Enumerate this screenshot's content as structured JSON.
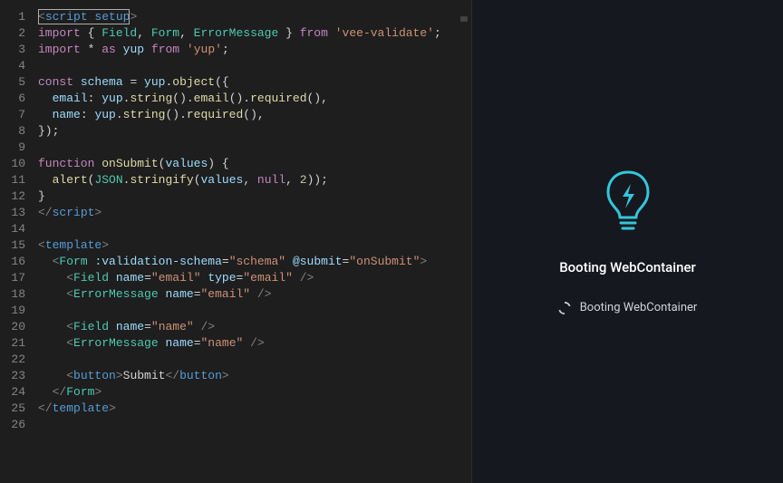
{
  "editor": {
    "lines": [
      {
        "n": 1,
        "tokens": [
          [
            "<",
            "punc"
          ],
          [
            "script setup",
            "tag"
          ],
          [
            ">",
            "punc"
          ]
        ],
        "cursor_start": true,
        "cursor_end_ch": 14
      },
      {
        "n": 2,
        "tokens": [
          [
            "import",
            "key"
          ],
          [
            " { ",
            "plain"
          ],
          [
            "Field",
            "type"
          ],
          [
            ", ",
            "plain"
          ],
          [
            "Form",
            "type"
          ],
          [
            ", ",
            "plain"
          ],
          [
            "ErrorMessage",
            "type"
          ],
          [
            " } ",
            "plain"
          ],
          [
            "from",
            "key"
          ],
          [
            " ",
            "plain"
          ],
          [
            "'vee-validate'",
            "str"
          ],
          [
            ";",
            "plain"
          ]
        ]
      },
      {
        "n": 3,
        "tokens": [
          [
            "import",
            "key"
          ],
          [
            " ",
            "plain"
          ],
          [
            "*",
            "op"
          ],
          [
            " ",
            "plain"
          ],
          [
            "as",
            "key"
          ],
          [
            " ",
            "plain"
          ],
          [
            "yup",
            "ident"
          ],
          [
            " ",
            "plain"
          ],
          [
            "from",
            "key"
          ],
          [
            " ",
            "plain"
          ],
          [
            "'yup'",
            "str"
          ],
          [
            ";",
            "plain"
          ]
        ]
      },
      {
        "n": 4,
        "tokens": []
      },
      {
        "n": 5,
        "tokens": [
          [
            "const",
            "key"
          ],
          [
            " ",
            "plain"
          ],
          [
            "schema",
            "ident"
          ],
          [
            " = ",
            "plain"
          ],
          [
            "yup",
            "ident"
          ],
          [
            ".",
            "plain"
          ],
          [
            "object",
            "fn"
          ],
          [
            "({",
            "plain"
          ]
        ]
      },
      {
        "n": 6,
        "tokens": [
          [
            "  ",
            "plain"
          ],
          [
            "email",
            "ident"
          ],
          [
            ": ",
            "plain"
          ],
          [
            "yup",
            "ident"
          ],
          [
            ".",
            "plain"
          ],
          [
            "string",
            "fn"
          ],
          [
            "().",
            "plain"
          ],
          [
            "email",
            "fn"
          ],
          [
            "().",
            "plain"
          ],
          [
            "required",
            "fn"
          ],
          [
            "(),",
            "plain"
          ]
        ]
      },
      {
        "n": 7,
        "tokens": [
          [
            "  ",
            "plain"
          ],
          [
            "name",
            "ident"
          ],
          [
            ": ",
            "plain"
          ],
          [
            "yup",
            "ident"
          ],
          [
            ".",
            "plain"
          ],
          [
            "string",
            "fn"
          ],
          [
            "().",
            "plain"
          ],
          [
            "required",
            "fn"
          ],
          [
            "(),",
            "plain"
          ]
        ]
      },
      {
        "n": 8,
        "tokens": [
          [
            "});",
            "plain"
          ]
        ]
      },
      {
        "n": 9,
        "tokens": []
      },
      {
        "n": 10,
        "tokens": [
          [
            "function",
            "key"
          ],
          [
            " ",
            "plain"
          ],
          [
            "onSubmit",
            "fn"
          ],
          [
            "(",
            "plain"
          ],
          [
            "values",
            "ident"
          ],
          [
            ") {",
            "plain"
          ]
        ]
      },
      {
        "n": 11,
        "tokens": [
          [
            "  ",
            "plain"
          ],
          [
            "alert",
            "fn"
          ],
          [
            "(",
            "plain"
          ],
          [
            "JSON",
            "type"
          ],
          [
            ".",
            "plain"
          ],
          [
            "stringify",
            "fn"
          ],
          [
            "(",
            "plain"
          ],
          [
            "values",
            "ident"
          ],
          [
            ", ",
            "plain"
          ],
          [
            "null",
            "key"
          ],
          [
            ", ",
            "plain"
          ],
          [
            "2",
            "num"
          ],
          [
            "));",
            "plain"
          ]
        ]
      },
      {
        "n": 12,
        "tokens": [
          [
            "}",
            "plain"
          ]
        ]
      },
      {
        "n": 13,
        "tokens": [
          [
            "</",
            "punc"
          ],
          [
            "script",
            "tag"
          ],
          [
            ">",
            "punc"
          ]
        ]
      },
      {
        "n": 14,
        "tokens": []
      },
      {
        "n": 15,
        "tokens": [
          [
            "<",
            "punc"
          ],
          [
            "template",
            "tag"
          ],
          [
            ">",
            "punc"
          ]
        ]
      },
      {
        "n": 16,
        "tokens": [
          [
            "  ",
            "plain"
          ],
          [
            "<",
            "punc"
          ],
          [
            "Form",
            "type"
          ],
          [
            " ",
            "plain"
          ],
          [
            ":validation-schema",
            "ident"
          ],
          [
            "=",
            "plain"
          ],
          [
            "\"schema\"",
            "str"
          ],
          [
            " ",
            "plain"
          ],
          [
            "@submit",
            "ident"
          ],
          [
            "=",
            "plain"
          ],
          [
            "\"onSubmit\"",
            "str"
          ],
          [
            ">",
            "punc"
          ]
        ]
      },
      {
        "n": 17,
        "tokens": [
          [
            "    ",
            "plain"
          ],
          [
            "<",
            "punc"
          ],
          [
            "Field",
            "type"
          ],
          [
            " ",
            "plain"
          ],
          [
            "name",
            "ident"
          ],
          [
            "=",
            "plain"
          ],
          [
            "\"email\"",
            "str"
          ],
          [
            " ",
            "plain"
          ],
          [
            "type",
            "ident"
          ],
          [
            "=",
            "plain"
          ],
          [
            "\"email\"",
            "str"
          ],
          [
            " />",
            "punc"
          ]
        ]
      },
      {
        "n": 18,
        "tokens": [
          [
            "    ",
            "plain"
          ],
          [
            "<",
            "punc"
          ],
          [
            "ErrorMessage",
            "type"
          ],
          [
            " ",
            "plain"
          ],
          [
            "name",
            "ident"
          ],
          [
            "=",
            "plain"
          ],
          [
            "\"email\"",
            "str"
          ],
          [
            " />",
            "punc"
          ]
        ]
      },
      {
        "n": 19,
        "tokens": []
      },
      {
        "n": 20,
        "tokens": [
          [
            "    ",
            "plain"
          ],
          [
            "<",
            "punc"
          ],
          [
            "Field",
            "type"
          ],
          [
            " ",
            "plain"
          ],
          [
            "name",
            "ident"
          ],
          [
            "=",
            "plain"
          ],
          [
            "\"name\"",
            "str"
          ],
          [
            " />",
            "punc"
          ]
        ]
      },
      {
        "n": 21,
        "tokens": [
          [
            "    ",
            "plain"
          ],
          [
            "<",
            "punc"
          ],
          [
            "ErrorMessage",
            "type"
          ],
          [
            " ",
            "plain"
          ],
          [
            "name",
            "ident"
          ],
          [
            "=",
            "plain"
          ],
          [
            "\"name\"",
            "str"
          ],
          [
            " />",
            "punc"
          ]
        ]
      },
      {
        "n": 22,
        "tokens": []
      },
      {
        "n": 23,
        "tokens": [
          [
            "    ",
            "plain"
          ],
          [
            "<",
            "punc"
          ],
          [
            "button",
            "tag"
          ],
          [
            ">",
            "punc"
          ],
          [
            "Submit",
            "plain"
          ],
          [
            "</",
            "punc"
          ],
          [
            "button",
            "tag"
          ],
          [
            ">",
            "punc"
          ]
        ]
      },
      {
        "n": 24,
        "tokens": [
          [
            "  ",
            "plain"
          ],
          [
            "</",
            "punc"
          ],
          [
            "Form",
            "type"
          ],
          [
            ">",
            "punc"
          ]
        ]
      },
      {
        "n": 25,
        "tokens": [
          [
            "</",
            "punc"
          ],
          [
            "template",
            "tag"
          ],
          [
            ">",
            "punc"
          ]
        ]
      },
      {
        "n": 26,
        "tokens": []
      }
    ]
  },
  "preview": {
    "title": "Booting WebContainer",
    "status_text": "Booting WebContainer",
    "icon_name": "lightbulb-bolt-icon",
    "accent": "#33c6dd"
  }
}
